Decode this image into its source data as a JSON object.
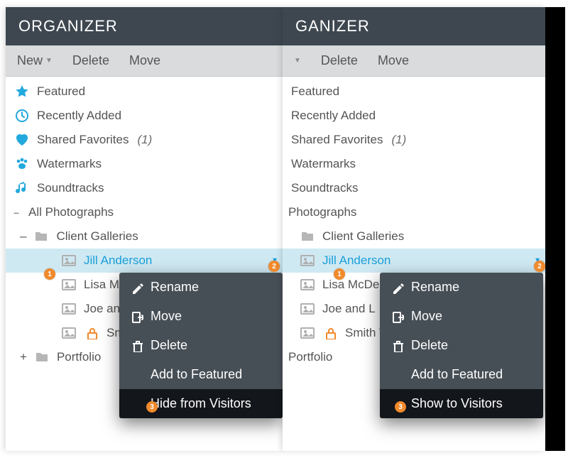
{
  "title": "ORGANIZER",
  "title_right": "GANIZER",
  "toolbar": {
    "new_label": "New",
    "delete_label": "Delete",
    "move_label": "Move"
  },
  "items": {
    "featured": "Featured",
    "recent": "Recently Added",
    "favs": "Shared Favorites",
    "favs_count": "(1)",
    "water": "Watermarks",
    "sound": "Soundtracks"
  },
  "tree": {
    "all": "All Photographs",
    "all_right": "Photographs",
    "client": "Client Galleries",
    "jill": "Jill Anderson",
    "lisa_left": "Lisa McD",
    "lisa_right": "Lisa McDe",
    "joe_left": "Joe and",
    "joe_right": "Joe and L",
    "smith_left": "Smith",
    "smith_right": "Smith W",
    "portfolio": "Portfolio"
  },
  "menu": {
    "rename": "Rename",
    "move": "Move",
    "delete": "Delete",
    "featured": "Add to Featured",
    "hide": "Hide from Visitors",
    "show": "Show to Visitors"
  },
  "badges": {
    "one": "1",
    "two": "2",
    "three": "3"
  },
  "icons": {
    "star": "star-icon",
    "clock": "clock-icon",
    "heart": "heart-icon",
    "paw": "paw-icon",
    "music": "music-icon",
    "folder": "folder-icon",
    "picture": "picture-icon",
    "lock": "lock-icon",
    "pencil": "pencil-icon",
    "move": "move-out-icon",
    "trash": "trash-icon"
  },
  "colors": {
    "accent": "#1aa0d9",
    "badge": "#f08a2c",
    "header": "#3e4750",
    "menu": "#474f56"
  }
}
